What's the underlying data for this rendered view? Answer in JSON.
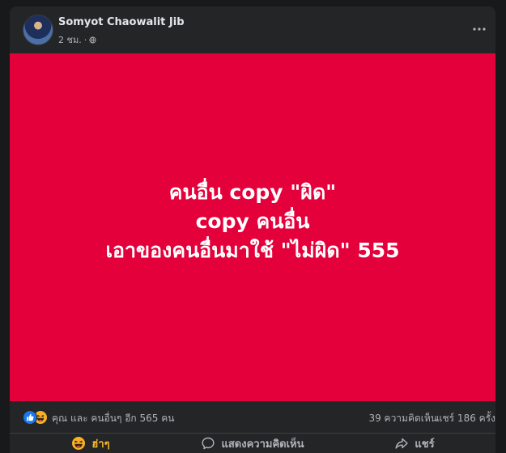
{
  "post": {
    "author": "Somyot Chaowalit Jib",
    "time": "2 ชม.",
    "separator": "·",
    "text_lines": [
      "คนอื่น copy \"ผิด\"",
      "copy คนอื่น",
      "เอาของคนอื่นมาใช้ \"ไม่ผิด\" 555"
    ]
  },
  "summary": {
    "reactions_text": "คุณ และ คนอื่นๆ อีก 565 คน",
    "comments": "39 ความคิดเห็น",
    "shares": "แชร์ 186 ครั้ง"
  },
  "actions": {
    "haha": "ฮ่าๆ",
    "comment": "แสดงความคิดเห็น",
    "share": "แชร์"
  },
  "colors": {
    "page_bg": "#18191a",
    "card_bg": "#242526",
    "media_bg": "#e4003a",
    "text_primary": "#e4e6eb",
    "text_secondary": "#b0b3b8",
    "haha_yellow": "#f7b928",
    "like_blue": "#1877f2"
  },
  "icons": {
    "more": "more-horizontal-icon",
    "privacy": "globe-icon",
    "like": "like-reaction-icon",
    "haha": "haha-reaction-icon",
    "comment": "comment-bubble-icon",
    "share": "share-arrow-icon"
  }
}
